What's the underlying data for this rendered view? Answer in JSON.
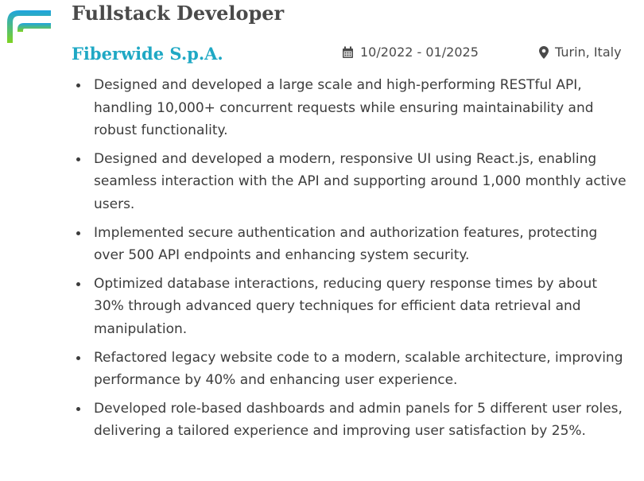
{
  "experience": {
    "title": "Fullstack Developer",
    "company": "Fiberwide S.p.A.",
    "dates": "10/2022 - 01/2025",
    "location": "Turin, Italy",
    "icons": {
      "logo": "company-logo",
      "dates": "calendar-icon",
      "location": "map-pin-icon"
    },
    "colors": {
      "company": "#1fa8c4",
      "logo_gradient": [
        "#1ea4e0",
        "#7ed321"
      ]
    },
    "bullets": [
      "Designed and developed a large scale and high-performing RESTful API, handling 10,000+ concurrent requests while ensuring maintainability and robust functionality.",
      "Designed and developed a modern, responsive UI using React.js, enabling seamless interaction with the API and supporting around 1,000 monthly active users.",
      "Implemented secure authentication and authorization features, protecting over 500 API endpoints and enhancing system security.",
      "Optimized database interactions, reducing query response times by about 30% through advanced query techniques for efficient data retrieval and manipulation.",
      "Refactored legacy website code to a modern, scalable architecture, improving performance by 40% and enhancing user experience.",
      "Developed role-based dashboards and admin panels for 5 different user roles, delivering a tailored experience and improving user satisfaction by 25%."
    ]
  }
}
